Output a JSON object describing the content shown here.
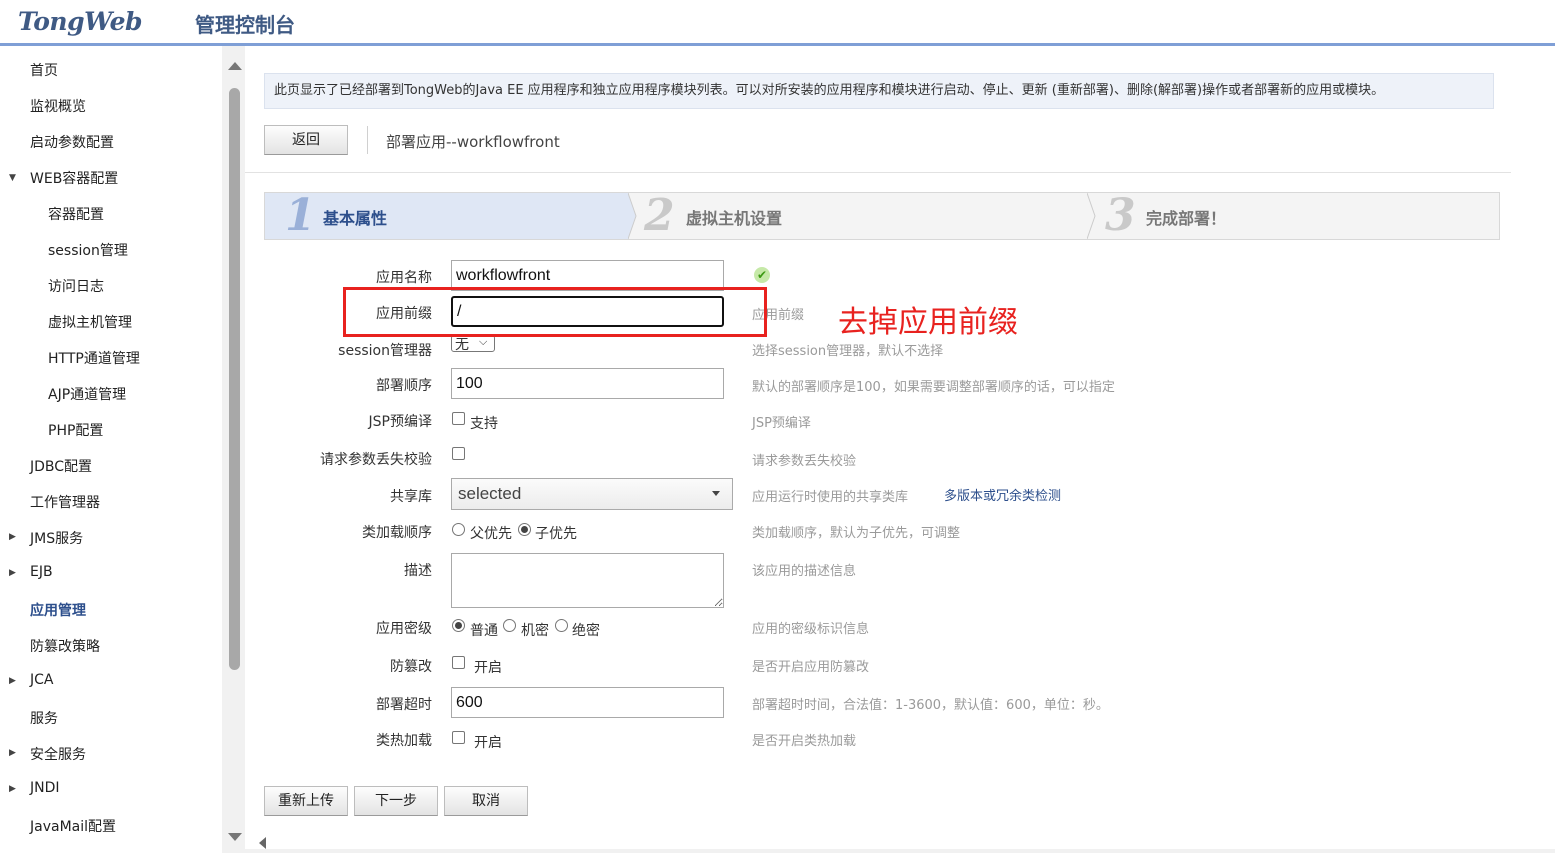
{
  "header": {
    "logo": "TongWeb",
    "subtitle": "管理控制台"
  },
  "sidebar": {
    "items": [
      {
        "label": "首页"
      },
      {
        "label": "监视概览"
      },
      {
        "label": "启动参数配置"
      },
      {
        "label": "WEB容器配置"
      },
      {
        "label": "容器配置"
      },
      {
        "label": "session管理"
      },
      {
        "label": "访问日志"
      },
      {
        "label": "虚拟主机管理"
      },
      {
        "label": "HTTP通道管理"
      },
      {
        "label": "AJP通道管理"
      },
      {
        "label": "PHP配置"
      },
      {
        "label": "JDBC配置"
      },
      {
        "label": "工作管理器"
      },
      {
        "label": "JMS服务"
      },
      {
        "label": "EJB"
      },
      {
        "label": "应用管理"
      },
      {
        "label": "防篡改策略"
      },
      {
        "label": "JCA"
      },
      {
        "label": "服务"
      },
      {
        "label": "安全服务"
      },
      {
        "label": "JNDI"
      },
      {
        "label": "JavaMail配置"
      }
    ]
  },
  "main": {
    "info_text": "此页显示了已经部署到TongWeb的Java EE 应用程序和独立应用程序模块列表。可以对所安装的应用程序和模块进行启动、停止、更新 (重新部署)、删除(解部署)操作或者部署新的应用或模块。",
    "back_button": "返回",
    "breadcrumb": "部署应用--workflowfront",
    "steps": [
      {
        "num": "1",
        "label": "基本属性"
      },
      {
        "num": "2",
        "label": "虚拟主机设置"
      },
      {
        "num": "3",
        "label": "完成部署！"
      }
    ],
    "form": {
      "app_name": {
        "label": "应用名称",
        "value": "workflowfront"
      },
      "app_prefix": {
        "label": "应用前缀",
        "value": "/",
        "hint": "应用前缀"
      },
      "session_manager": {
        "label": "session管理器",
        "value": "无",
        "hint": "选择session管理器，默认不选择"
      },
      "deploy_order": {
        "label": "部署顺序",
        "value": "100",
        "hint": "默认的部署顺序是100，如果需要调整部署顺序的话，可以指定"
      },
      "jsp_precompile": {
        "label": "JSP预编译",
        "option": "支持",
        "hint": "JSP预编译"
      },
      "param_loss_check": {
        "label": "请求参数丢失校验",
        "hint": "请求参数丢失校验"
      },
      "shared_lib": {
        "label": "共享库",
        "value": "selected",
        "hint": "应用运行时使用的共享类库",
        "link": "多版本或冗余类检测"
      },
      "class_load_order": {
        "label": "类加载顺序",
        "options": [
          "父优先",
          "子优先"
        ],
        "hint": "类加载顺序，默认为子优先，可调整"
      },
      "description": {
        "label": "描述",
        "value": "",
        "hint": "该应用的描述信息"
      },
      "security_level": {
        "label": "应用密级",
        "options": [
          "普通",
          "机密",
          "绝密"
        ],
        "hint": "应用的密级标识信息"
      },
      "tamper_proof": {
        "label": "防篡改",
        "option": "开启",
        "hint": "是否开启应用防篡改"
      },
      "deploy_timeout": {
        "label": "部署超时",
        "value": "600",
        "hint": "部署超时时间，合法值：1-3600，默认值：600，单位：秒。"
      },
      "hot_reload": {
        "label": "类热加载",
        "option": "开启",
        "hint": "是否开启类热加载"
      }
    },
    "buttons": {
      "reupload": "重新上传",
      "next": "下一步",
      "cancel": "取消"
    },
    "annotation": "去掉应用前缀"
  },
  "colors": {
    "accent": "#2d4f8c",
    "annotation": "#e8221f",
    "step_active_bg": "#dfe7f5"
  }
}
